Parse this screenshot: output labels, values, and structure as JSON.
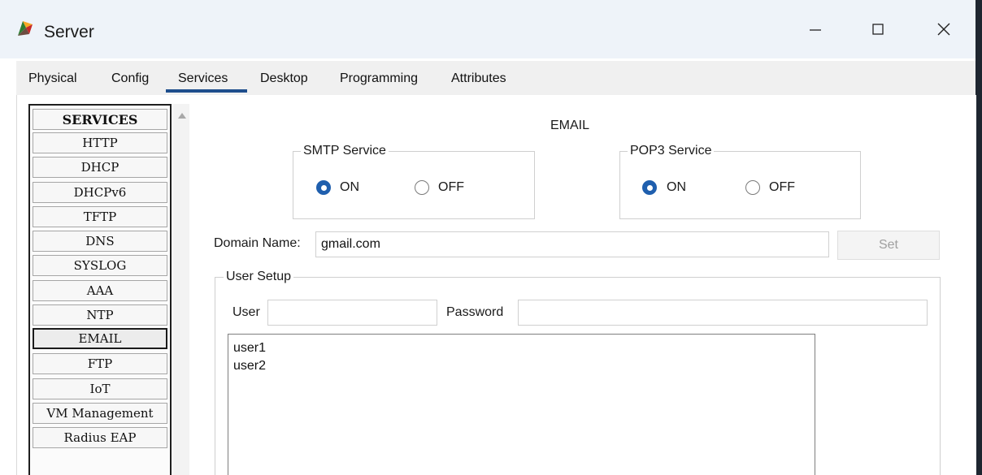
{
  "window": {
    "title": "Server",
    "icon": "packet-tracer-icon",
    "controls": {
      "minimize": "minimize-icon",
      "maximize": "maximize-icon",
      "close": "close-icon"
    }
  },
  "tabs": [
    {
      "label": "Physical"
    },
    {
      "label": "Config"
    },
    {
      "label": "Services",
      "active": true
    },
    {
      "label": "Desktop"
    },
    {
      "label": "Programming"
    },
    {
      "label": "Attributes"
    }
  ],
  "services": {
    "header": "SERVICES",
    "items": [
      "HTTP",
      "DHCP",
      "DHCPv6",
      "TFTP",
      "DNS",
      "SYSLOG",
      "AAA",
      "NTP",
      "EMAIL",
      "FTP",
      "IoT",
      "VM Management",
      "Radius EAP"
    ],
    "selected": "EMAIL"
  },
  "email": {
    "title": "EMAIL",
    "smtp": {
      "legend": "SMTP Service",
      "on_label": "ON",
      "off_label": "OFF",
      "state": "ON"
    },
    "pop3": {
      "legend": "POP3 Service",
      "on_label": "ON",
      "off_label": "OFF",
      "state": "ON"
    },
    "domain": {
      "label": "Domain Name:",
      "value": "gmail.com",
      "set_label": "Set"
    },
    "user_setup": {
      "legend": "User Setup",
      "user_label": "User",
      "user_value": "",
      "password_label": "Password",
      "password_value": "",
      "users": [
        "user1",
        "user2"
      ]
    }
  },
  "colors": {
    "accent": "#1f5fae",
    "tab_underline": "#1e4e8c"
  }
}
